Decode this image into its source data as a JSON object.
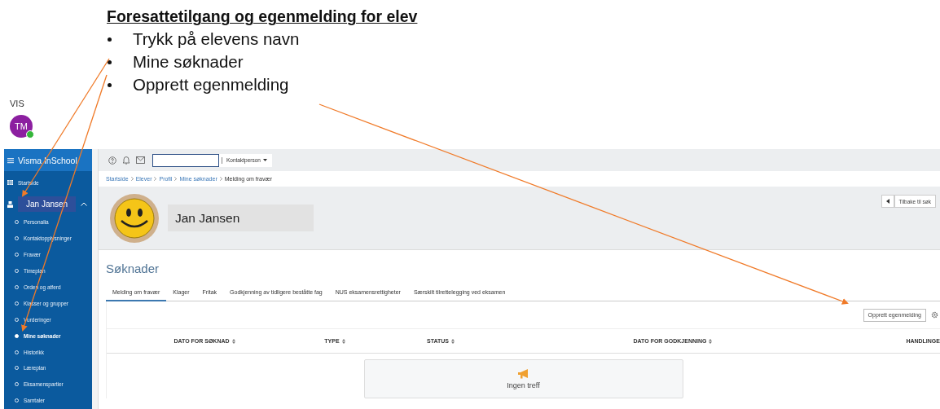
{
  "slide": {
    "title": "Foresattetilgang og egenmelding for elev",
    "bullets": [
      "Trykk på elevens navn",
      "Mine søknader",
      "Opprett egenmelding"
    ]
  },
  "user": {
    "label": "VIS",
    "initials": "TM",
    "online": true
  },
  "sidebar": {
    "app_title": "Visma InSchool",
    "home": "Startside",
    "student": {
      "name": "Jan Jansen",
      "expanded": true
    },
    "items": [
      {
        "label": "Personalia",
        "selected": false
      },
      {
        "label": "Kontaktopplysninger",
        "selected": false
      },
      {
        "label": "Fravær",
        "selected": false
      },
      {
        "label": "Timeplan",
        "selected": false
      },
      {
        "label": "Orden og atferd",
        "selected": false
      },
      {
        "label": "Klasser og grupper",
        "selected": false
      },
      {
        "label": "Vurderinger",
        "selected": false
      },
      {
        "label": "Mine søknader",
        "selected": true
      },
      {
        "label": "Historikk",
        "selected": false
      },
      {
        "label": "Læreplan",
        "selected": false
      },
      {
        "label": "Eksamenspartier",
        "selected": false
      },
      {
        "label": "Samtaler",
        "selected": false
      }
    ]
  },
  "topbar": {
    "contact_dropdown": "Kontaktperson"
  },
  "breadcrumb": [
    {
      "label": "Startside",
      "link": true
    },
    {
      "label": "Elever",
      "link": true
    },
    {
      "label": "Profil",
      "link": true
    },
    {
      "label": "Mine søknader",
      "link": true
    },
    {
      "label": "Melding om fravær",
      "link": false
    }
  ],
  "profile": {
    "name": "Jan Jansen",
    "back_button": "Tilbake til søk"
  },
  "page_title": "Søknader",
  "tabs": [
    {
      "label": "Melding om fravær",
      "selected": true
    },
    {
      "label": "Klager",
      "selected": false
    },
    {
      "label": "Fritak",
      "selected": false
    },
    {
      "label": "Godkjenning av tidligere beståtte fag",
      "selected": false
    },
    {
      "label": "NUS eksamensrettigheter",
      "selected": false
    },
    {
      "label": "Særskilt tilrettelegging ved eksamen",
      "selected": false
    }
  ],
  "table": {
    "action_button": "Opprett egenmelding",
    "columns": [
      {
        "label": "DATO FOR SØKNAD",
        "sortable": true
      },
      {
        "label": "TYPE",
        "sortable": true
      },
      {
        "label": "STATUS",
        "sortable": true
      },
      {
        "label": "DATO FOR GODKJENNING",
        "sortable": true
      },
      {
        "label": "HANDLINGE",
        "sortable": false
      }
    ],
    "empty_text": "Ingen treff"
  }
}
